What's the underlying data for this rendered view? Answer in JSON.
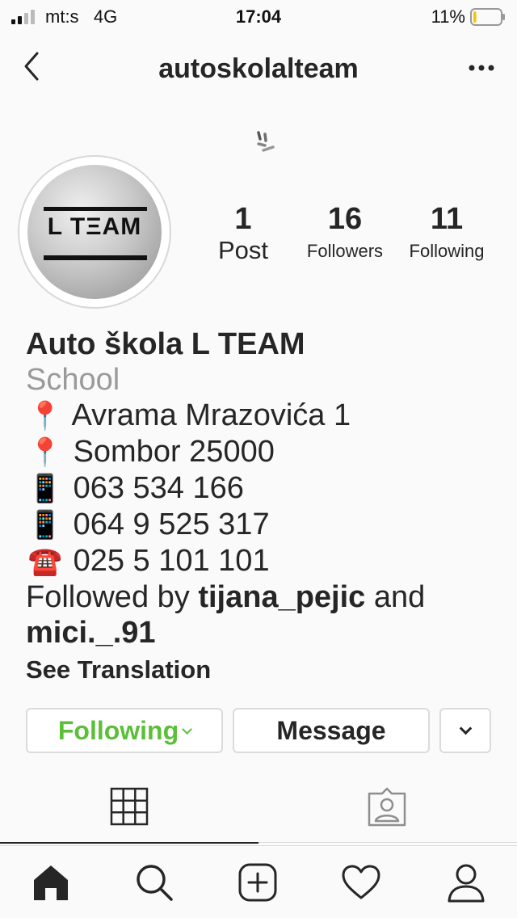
{
  "status_bar": {
    "carrier": "mt:s",
    "network": "4G",
    "time": "17:04",
    "battery": "11%",
    "battery_level": 0.11
  },
  "header": {
    "username": "autoskolalteam"
  },
  "avatar": {
    "logo_text": "L TΞAM"
  },
  "stats": {
    "posts": {
      "count": "1",
      "label": "Post"
    },
    "followers": {
      "count": "16",
      "label": "Followers"
    },
    "following": {
      "count": "11",
      "label": "Following"
    }
  },
  "bio": {
    "name": "Auto škola L TEAM",
    "category": "School",
    "lines": [
      {
        "icon": "pin-icon",
        "emoji": "📍",
        "text": "Avrama Mrazovića 1"
      },
      {
        "icon": "pin-icon",
        "emoji": "📍",
        "text": "Sombor 25000"
      },
      {
        "icon": "mobile-phone-icon",
        "emoji": "📱",
        "text": "063 534 166"
      },
      {
        "icon": "mobile-phone-icon",
        "emoji": "📱",
        "text": "064 9 525 317"
      },
      {
        "icon": "telephone-icon",
        "emoji": "☎️",
        "text": "025 5 101 101"
      }
    ],
    "followed_by_prefix": "Followed by",
    "followed_by_user1": "tijana_pejic",
    "followed_by_and": "and",
    "followed_by_user2": "mici._.91",
    "see_translation": "See Translation"
  },
  "buttons": {
    "following": "Following",
    "message": "Message"
  },
  "colors": {
    "following_green": "#5cbf3a",
    "text": "#262626",
    "muted": "#9a9a9a",
    "border": "#dbdbdb"
  }
}
